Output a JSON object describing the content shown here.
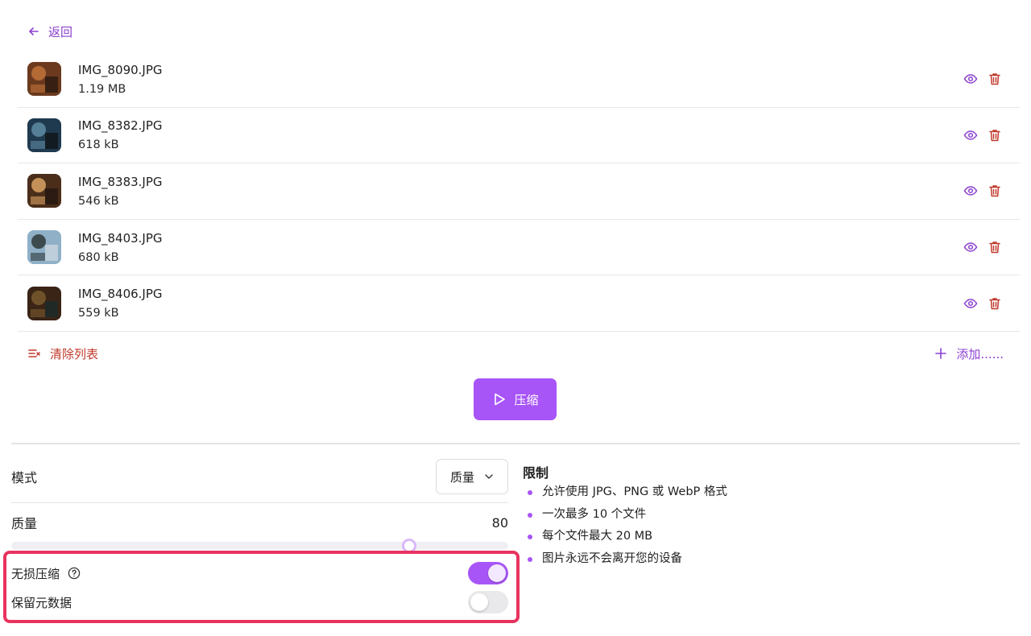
{
  "nav": {
    "back_label": "返回"
  },
  "files": [
    {
      "name": "IMG_8090.JPG",
      "size": "1.19 MB",
      "thumb_colors": [
        "#6b3a1e",
        "#c0733a",
        "#2b1a10"
      ]
    },
    {
      "name": "IMG_8382.JPG",
      "size": "618 kB",
      "thumb_colors": [
        "#1f3a4f",
        "#5f8ba3",
        "#101417"
      ]
    },
    {
      "name": "IMG_8383.JPG",
      "size": "546 kB",
      "thumb_colors": [
        "#4a2e1a",
        "#d9a264",
        "#231710"
      ]
    },
    {
      "name": "IMG_8403.JPG",
      "size": "680 kB",
      "thumb_colors": [
        "#8fb0c7",
        "#2f3a3a",
        "#c9d6df"
      ]
    },
    {
      "name": "IMG_8406.JPG",
      "size": "559 kB",
      "thumb_colors": [
        "#3a2416",
        "#7a5a2e",
        "#1c2a2a"
      ]
    }
  ],
  "list_actions": {
    "clear_label": "清除列表",
    "add_label": "添加......"
  },
  "compress": {
    "label": "压缩"
  },
  "settings": {
    "mode_label": "模式",
    "mode_value": "质量",
    "quality_label": "质量",
    "quality_value": "80",
    "quality_fraction": 0.8,
    "lossless_label": "无损压缩",
    "lossless_on": true,
    "keep_metadata_label": "保留元数据",
    "keep_metadata_on": false
  },
  "limits": {
    "title": "限制",
    "items": [
      "允许使用 JPG、PNG 或 WebP 格式",
      "一次最多 10 个文件",
      "每个文件最大 20 MB",
      "图片永远不会离开您的设备"
    ]
  },
  "colors": {
    "accent": "#a855f7",
    "link": "#8b3fd0",
    "danger": "#c0392b",
    "highlight": "#e8335f"
  }
}
